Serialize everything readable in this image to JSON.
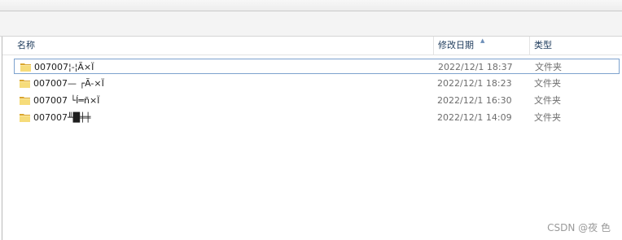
{
  "columns": {
    "name": "名称",
    "date": "修改日期",
    "type": "类型"
  },
  "sort_indicator": "▲",
  "files": [
    {
      "name": "007007¦-¦Ã×Ï",
      "date": "2022/12/1 18:37",
      "type": "文件夹",
      "selected": true
    },
    {
      "name": "007007— ┌Ã-×Ï",
      "date": "2022/12/1 18:23",
      "type": "文件夹",
      "selected": false
    },
    {
      "name": "007007 └Í═ñ×Ï",
      "date": "2022/12/1 16:30",
      "type": "文件夹",
      "selected": false
    },
    {
      "name": "007007╨█╪╪",
      "date": "2022/12/1 14:09",
      "type": "文件夹",
      "selected": false
    }
  ],
  "icons": {
    "folder": "folder-icon"
  },
  "colors": {
    "folder_light": "#f6dc7a",
    "folder_dark": "#d9a52e",
    "selection_border": "#7da2ce"
  },
  "watermark": "CSDN @夜 色"
}
